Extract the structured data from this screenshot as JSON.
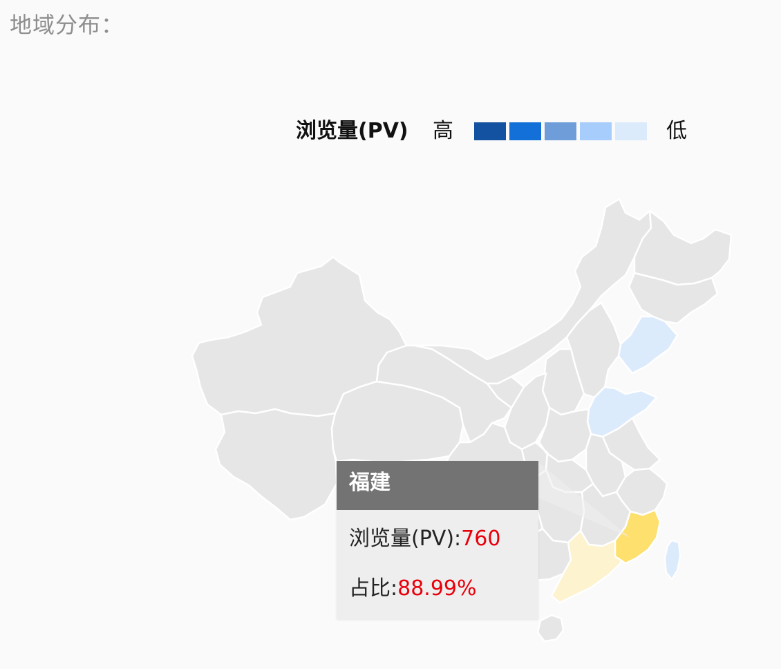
{
  "section_title": "地域分布：",
  "legend": {
    "title": "浏览量(PV)",
    "high_label": "高",
    "low_label": "低",
    "colors": [
      "#1352a0",
      "#1270d8",
      "#6f9dd9",
      "#a6cdfb",
      "#dcebfc"
    ]
  },
  "map": {
    "base_color": "#e6e6e6",
    "regions": [
      {
        "name": "黑龙江",
        "color": "#e6e6e6"
      },
      {
        "name": "吉林",
        "color": "#e6e6e6"
      },
      {
        "name": "辽宁",
        "color": "#dcebfc"
      },
      {
        "name": "山东",
        "color": "#dcebfc"
      },
      {
        "name": "台湾",
        "color": "#dcebfc"
      },
      {
        "name": "福建",
        "color": "#fee06f"
      },
      {
        "name": "广东",
        "color": "#fdf3cf"
      }
    ]
  },
  "tooltip": {
    "title": "福建",
    "pv_label": "浏览量(PV):",
    "pv_value": "760",
    "ratio_label": "占比:",
    "ratio_value": "88.99%"
  }
}
